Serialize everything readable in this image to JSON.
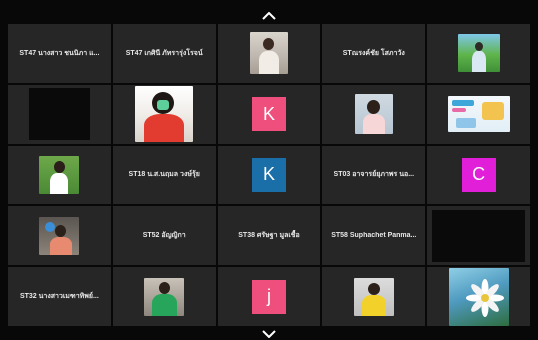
{
  "nav": {
    "up_icon": "chevron-up-icon",
    "down_icon": "chevron-down-icon"
  },
  "colors": {
    "avatar_pink": "#ee4f7c",
    "avatar_blue": "#1b6fa8",
    "avatar_magenta": "#e11fd8",
    "tile_bg": "#262626"
  },
  "tiles": {
    "r1c1": {
      "name": "ST47 นางสาว ชนนิภา แ..."
    },
    "r1c2": {
      "name": "ST47 เกศินี ภัทรารุ่งโรจน์"
    },
    "r1c4": {
      "name": "STณรงค์ชัย โสภาวัง"
    },
    "r2c3": {
      "initial": "K"
    },
    "r3c2": {
      "name": "ST18 น.ส.นฤมล วงษ์รุ้ย"
    },
    "r3c3": {
      "initial": "K"
    },
    "r3c4": {
      "name": "ST03 อาจารย์ยุภาพร นอ..."
    },
    "r3c5": {
      "initial": "C"
    },
    "r4c2": {
      "name": "ST52 อัญญิกา"
    },
    "r4c3": {
      "name": "ST38 ศรัษฐา มูลเชื้อ"
    },
    "r4c4": {
      "name": "ST58 Suphachet Panma..."
    },
    "r5c1": {
      "name": "ST32 นางสาวเมฑาทิพย์..."
    },
    "r5c3": {
      "initial": "j"
    }
  }
}
